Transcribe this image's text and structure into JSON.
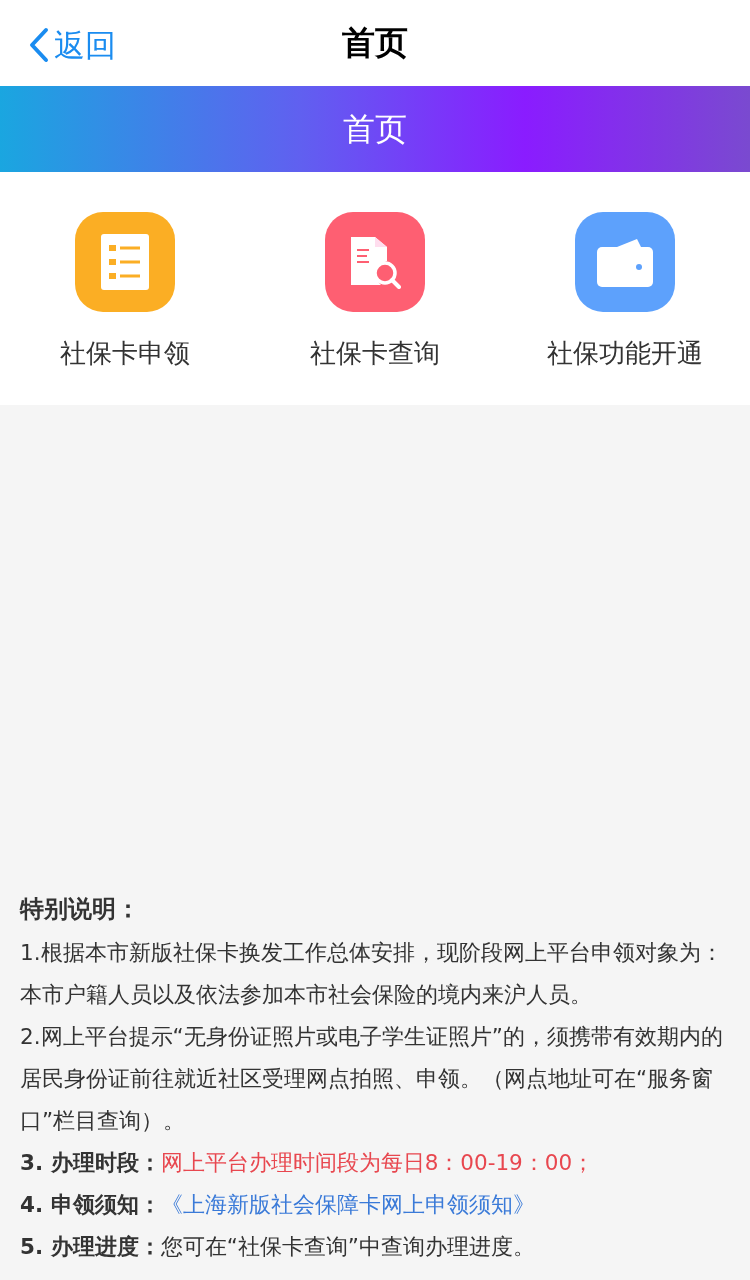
{
  "nav": {
    "back": "返回",
    "title": "首页"
  },
  "banner": {
    "title": "首页"
  },
  "services": [
    {
      "kind": "list",
      "label": "社保卡申领",
      "color": "#fbae24"
    },
    {
      "kind": "search",
      "label": "社保卡查询",
      "color": "#fe5f72"
    },
    {
      "kind": "wallet",
      "label": "社保功能开通",
      "color": "#5da1fc"
    }
  ],
  "notes": {
    "title": "特别说明：",
    "paragraphs": [
      "1.根据本市新版社保卡换发工作总体安排，现阶段网上平台申领对象为：本市户籍人员以及依法参加本市社会保险的境内来沪人员。",
      "2.网上平台提示“无身份证照片或电子学生证照片”的，须携带有效期内的居民身份证前往就近社区受理网点拍照、申领。（网点地址可在“服务窗口”栏目查询）。"
    ],
    "items": [
      {
        "label": "3. 办理时段：",
        "kind": "highlight",
        "text": "网上平台办理时间段为每日8：00-19：00；"
      },
      {
        "label": "4. 申领须知：",
        "kind": "link",
        "text": "《上海新版社会保障卡网上申领须知》"
      },
      {
        "label": "5. 办理进度：",
        "kind": "plain",
        "text": "您可在“社保卡查询”中查询办理进度。"
      }
    ]
  }
}
